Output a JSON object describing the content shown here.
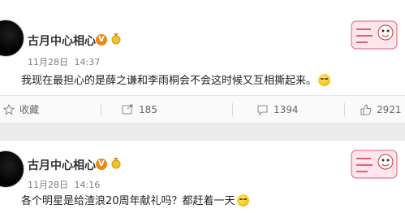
{
  "posts": [
    {
      "username": "古月中心相心",
      "verified_badge": "V",
      "medal_icon": "gold-medal-icon",
      "date": "11月28日",
      "time": "14:37",
      "text": "我现在最担心的是薛之谦和李雨桐会不会这时候又互相撕起来。",
      "emoji_icon": "sweat-laugh-emoji-icon",
      "stamp_icon": "cartoon-sticker-icon",
      "actions": {
        "favorite_label": "收藏",
        "share_count": "185",
        "comment_count": "1394",
        "like_count": "2921"
      }
    },
    {
      "username": "古月中心相心",
      "verified_badge": "V",
      "medal_icon": "gold-medal-icon",
      "date": "11月28日",
      "time": "14:16",
      "text": "各个明星是给渣浪20周年献礼吗？都赶着一天",
      "emoji_icon": "sweat-laugh-emoji-icon",
      "stamp_icon": "cartoon-sticker-icon"
    }
  ],
  "colors": {
    "badge_orange": "#e8891d",
    "text": "#222222",
    "meta": "#808080"
  }
}
